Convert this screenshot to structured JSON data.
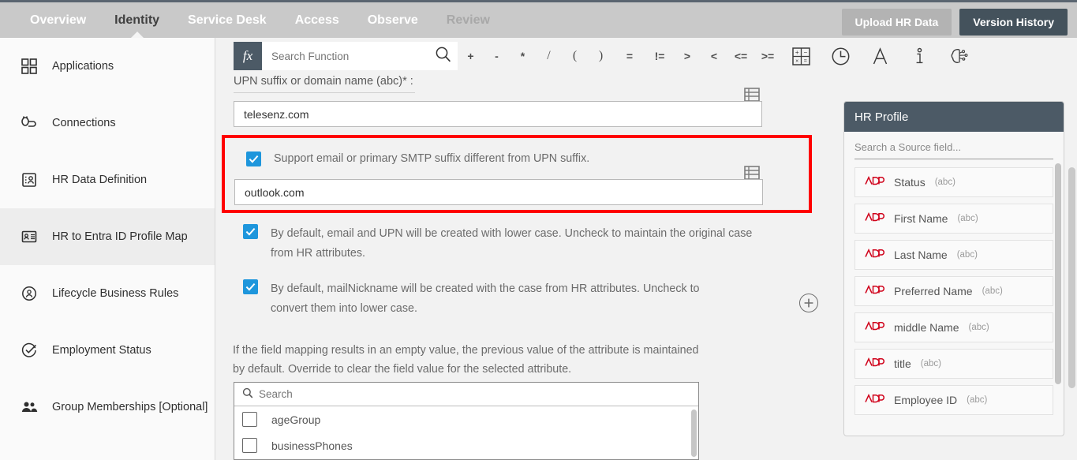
{
  "topnav": {
    "tabs": [
      {
        "label": "Overview",
        "state": "normal"
      },
      {
        "label": "Identity",
        "state": "active"
      },
      {
        "label": "Service Desk",
        "state": "normal"
      },
      {
        "label": "Access",
        "state": "normal"
      },
      {
        "label": "Observe",
        "state": "normal"
      },
      {
        "label": "Review",
        "state": "dim"
      }
    ],
    "upload_button": "Upload HR Data",
    "version_button": "Version History"
  },
  "sidebar": {
    "items": [
      {
        "label": "Applications",
        "icon": "grid-apps-icon",
        "active": false
      },
      {
        "label": "Connections",
        "icon": "plug-connection-icon",
        "active": false
      },
      {
        "label": "HR Data Definition",
        "icon": "hr-data-card-icon",
        "active": false
      },
      {
        "label": "HR to Entra ID Profile Map",
        "icon": "profile-map-card-icon",
        "active": true
      },
      {
        "label": "Lifecycle Business Rules",
        "icon": "lifecycle-circle-user-icon",
        "active": false
      },
      {
        "label": "Employment Status",
        "icon": "check-circle-icon",
        "active": false
      },
      {
        "label": "Group Memberships [Optional]",
        "icon": "people-group-icon",
        "active": false
      }
    ]
  },
  "formula_bar": {
    "fx_label": "fx",
    "search_placeholder": "Search Function",
    "search_value": "",
    "search_icon": "search-icon",
    "operators": [
      "+",
      "-",
      "*",
      "/",
      "(",
      ")",
      "=",
      "!=",
      ">",
      "<",
      "<=",
      ">="
    ],
    "icons": [
      {
        "name": "calculator-icon"
      },
      {
        "name": "clock-icon"
      },
      {
        "name": "text-format-icon"
      },
      {
        "name": "info-icon"
      },
      {
        "name": "ai-brain-icon"
      }
    ]
  },
  "main": {
    "upn_field": {
      "label": "UPN suffix or domain name (abc)",
      "required_mark": "*",
      "colon": ":",
      "value": "telesenz.com",
      "grid_icon": "table-grid-icon"
    },
    "smtp_block": {
      "checkbox_checked": true,
      "checkbox_label": "Support email or primary SMTP suffix different from UPN suffix.",
      "value": "outlook.com",
      "grid_icon": "table-grid-icon",
      "highlight_color": "#ff0000"
    },
    "options": [
      {
        "checked": true,
        "text": "By default, email and UPN will be created with lower case. Uncheck to maintain the original case from HR attributes."
      },
      {
        "checked": true,
        "text": "By default, mailNickname will be created with the case from HR attributes. Uncheck to convert them into lower case."
      }
    ],
    "note": "If the field mapping results in an empty value, the previous value of the attribute is maintained by default. Override to clear the field value for the selected attribute.",
    "attribute_list": {
      "search_placeholder": "Search",
      "search_icon": "search-icon",
      "items": [
        {
          "label": "ageGroup",
          "checked": false
        },
        {
          "label": "businessPhones",
          "checked": false
        }
      ]
    },
    "add_button": "add-circle-icon"
  },
  "hr_profile": {
    "title": "HR Profile",
    "search_placeholder": "Search a Source field...",
    "fields": [
      {
        "name": "Status",
        "type": "(abc)",
        "source": "ADP"
      },
      {
        "name": "First Name",
        "type": "(abc)",
        "source": "ADP"
      },
      {
        "name": "Last Name",
        "type": "(abc)",
        "source": "ADP"
      },
      {
        "name": "Preferred Name",
        "type": "(abc)",
        "source": "ADP"
      },
      {
        "name": "middle Name",
        "type": "(abc)",
        "source": "ADP"
      },
      {
        "name": "title",
        "type": "(abc)",
        "source": "ADP"
      },
      {
        "name": "Employee ID",
        "type": "(abc)",
        "source": "ADP"
      }
    ]
  },
  "colors": {
    "nav_bg": "#c9c9c9",
    "accent_dark": "#44525c",
    "checkbox_blue": "#1e96dc",
    "highlight_red": "#ff0000",
    "adp_red": "#d0021b"
  }
}
